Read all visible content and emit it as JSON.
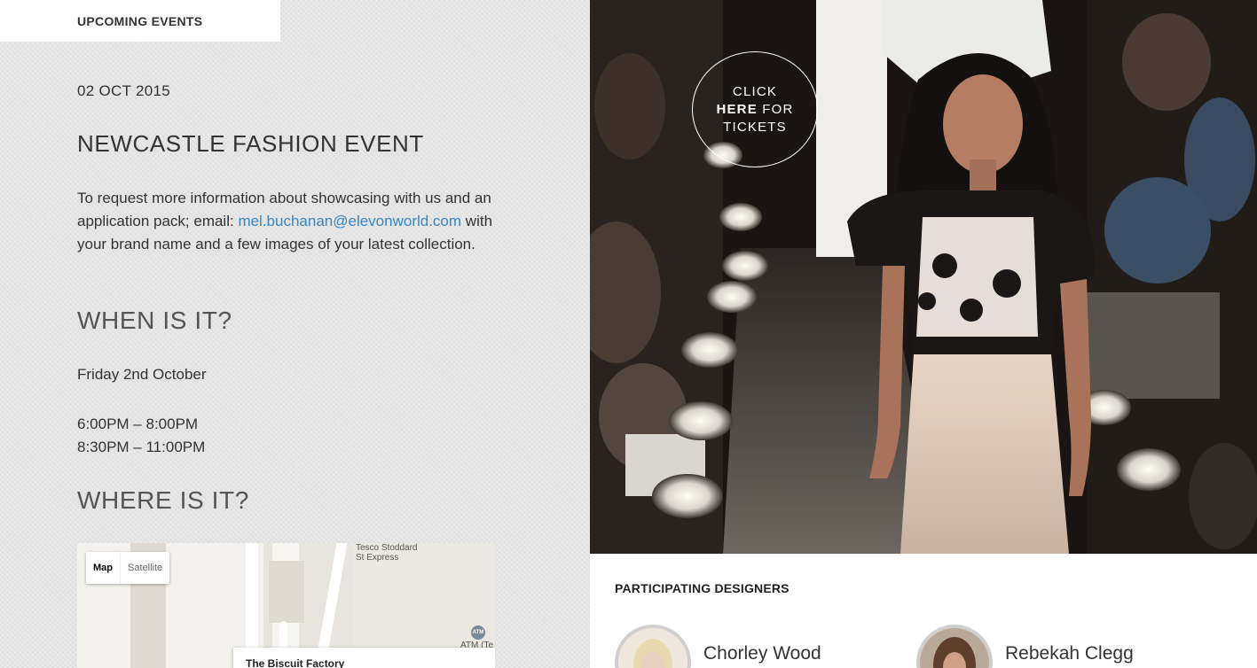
{
  "header": {
    "tab_label": "UPCOMING EVENTS"
  },
  "event": {
    "date": "02 OCT 2015",
    "title": "NEWCASTLE FASHION EVENT",
    "desc_part1": "To request more information about showcasing with us and an application pack; email: ",
    "email": "mel.buchanan@elevonworld.com",
    "desc_part2": " with your brand name and a few images of your latest collection.",
    "when_heading": "WHEN IS IT?",
    "day": "Friday 2nd October",
    "time_1": "6:00PM – 8:00PM",
    "time_2": "8:30PM – 11:00PM",
    "where_heading": "WHERE IS IT?"
  },
  "map": {
    "toggle_map": "Map",
    "toggle_satellite": "Satellite",
    "poi_line1": "Tesco Stoddard",
    "poi_line2": "St Express",
    "atm_label": "ATM (Te",
    "atm_icon_text": "ATM",
    "popup_title": "The Biscuit Factory"
  },
  "hero": {
    "cta_line1": "CLICK",
    "cta_here": "HERE",
    "cta_for": " FOR",
    "cta_line3": "TICKETS"
  },
  "designers": {
    "title": "PARTICIPATING DESIGNERS",
    "items": [
      {
        "name": "Chorley Wood"
      },
      {
        "name": "Rebekah Clegg"
      }
    ]
  }
}
